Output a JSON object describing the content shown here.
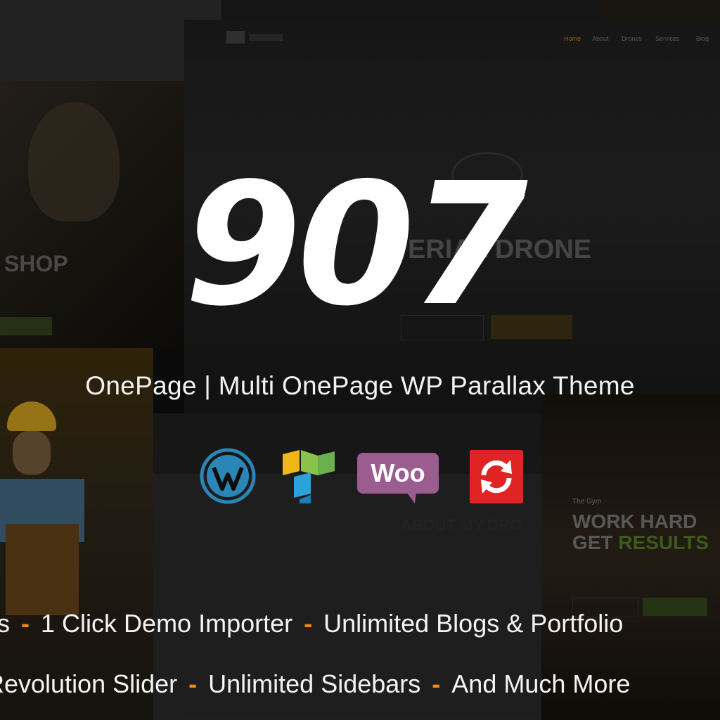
{
  "hero": {
    "number": "907",
    "subtitle": "OnePage | Multi OnePage WP Parallax Theme"
  },
  "features": {
    "line1": [
      "ps",
      "1 Click Demo Importer",
      "Unlimited Blogs & Portfolio"
    ],
    "line2": [
      "Revolution Slider",
      "Unlimited Sidebars",
      "And Much More"
    ],
    "separator": "-"
  },
  "plugins": [
    {
      "name": "wordpress-icon"
    },
    {
      "name": "visual-composer-icon"
    },
    {
      "name": "woocommerce-icon",
      "label": "Woo"
    },
    {
      "name": "slider-revolution-icon"
    }
  ],
  "background": {
    "drone_nav": [
      "Home",
      "About",
      "Drones",
      "Services",
      "Blog"
    ],
    "drone_heading": "ERIAL DRONE",
    "shop_heading": "SHOP",
    "about_heading": "ABOUT MY DRO",
    "gym_small": "The Gym",
    "gym_line1": "WORK HARD",
    "gym_line2_a": "GET",
    "gym_line2_b": "RESULTS"
  },
  "colors": {
    "accent": "#f08a1c",
    "text": "#ffffff",
    "woo_purple": "#9b5c8f",
    "wordpress_blue": "#2b86b8",
    "revslider_red": "#e02424",
    "gym_green": "#5a9a2a"
  }
}
